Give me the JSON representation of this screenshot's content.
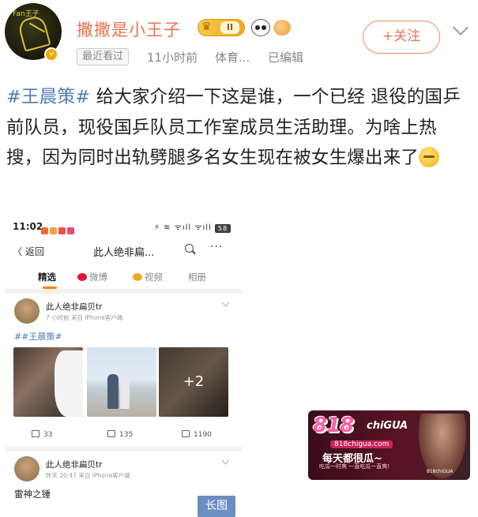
{
  "post": {
    "username": "撒撒是小王子",
    "level_badge": "II",
    "recent_tag": "最近看过",
    "time": "11小时前",
    "source": "体育...",
    "edited": "已编辑",
    "follow_label": "+关注",
    "hashtag": "#王晨策#",
    "text_body": " 给大家介绍一下这是谁，一个已经 退役的国乒前队员，现役国乒队员工作室成员生活助理。为啥上热搜，因为同时出轨劈腿多名女生现在被女生爆出来了",
    "avatar_text": "Fan王子"
  },
  "screenshot": {
    "status_time": "11:02",
    "status_right": "⚡ ≋ ᯤıll ᯤıll",
    "battery": "58",
    "nav_back": "〈 返回",
    "nav_title": "此人绝非扁...",
    "nav_more": "···",
    "tabs": [
      "精选",
      "微博",
      "视频",
      "相册"
    ],
    "posts": [
      {
        "name": "此人绝非扁贝tr",
        "meta": "7 小时前  来自 iPhone客户端",
        "body": "##王晨策#",
        "photo_more": "+2",
        "reposts": "33",
        "comments": "135",
        "likes": "1190"
      },
      {
        "name": "此人绝非扁贝tr",
        "meta": "昨天 20:47  来自 iPhone客户端",
        "body": "雷神之锤"
      }
    ],
    "long_image": "长图"
  },
  "watermark": {
    "logo": "818",
    "logo_small": "chiGUA",
    "domain": "818chigua.com",
    "slogan": "每天都很瓜~",
    "sub": "吃瓜一时爽 一直吃瓜一直爽!",
    "foot": "818chiGUA"
  },
  "colors": {
    "username": "#eb7350",
    "hashtag": "#507daf",
    "accent": "#ff8200"
  }
}
